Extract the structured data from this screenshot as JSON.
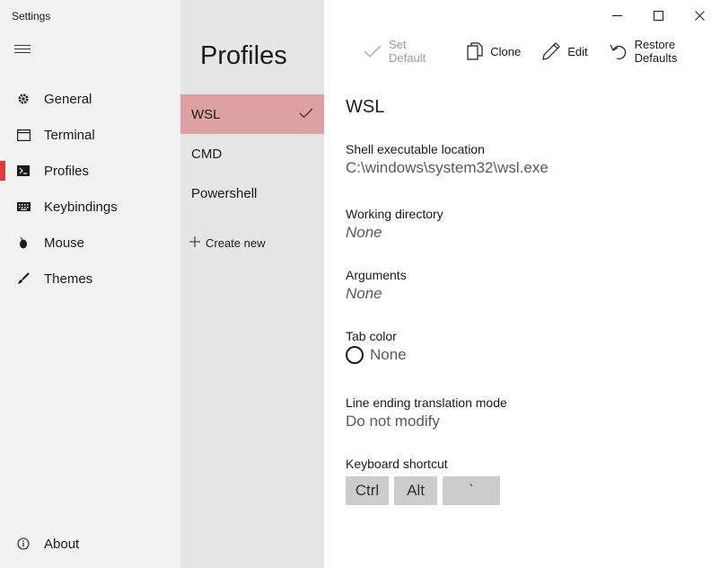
{
  "window": {
    "title": "Settings"
  },
  "nav": {
    "items": [
      {
        "label": "General",
        "icon": "gear-icon"
      },
      {
        "label": "Terminal",
        "icon": "window-icon"
      },
      {
        "label": "Profiles",
        "icon": "terminal-prompt-icon",
        "active": true
      },
      {
        "label": "Keybindings",
        "icon": "keyboard-icon"
      },
      {
        "label": "Mouse",
        "icon": "mouse-icon"
      },
      {
        "label": "Themes",
        "icon": "brush-icon"
      }
    ],
    "about": {
      "label": "About",
      "icon": "info-icon"
    }
  },
  "profiles": {
    "title": "Profiles",
    "items": [
      {
        "label": "WSL",
        "selected": true
      },
      {
        "label": "CMD"
      },
      {
        "label": "Powershell"
      }
    ],
    "create_new": "Create new"
  },
  "toolbar": {
    "set_default": "Set Default",
    "clone": "Clone",
    "edit": "Edit",
    "restore_defaults": "Restore Defaults"
  },
  "detail": {
    "name": "WSL",
    "shell_label": "Shell executable location",
    "shell_value": "C:\\windows\\system32\\wsl.exe",
    "workdir_label": "Working directory",
    "workdir_value": "None",
    "args_label": "Arguments",
    "args_value": "None",
    "tabcolor_label": "Tab color",
    "tabcolor_value": "None",
    "lineending_label": "Line ending translation mode",
    "lineending_value": "Do not modify",
    "shortcut_label": "Keyboard shortcut",
    "shortcut_keys": [
      "Ctrl",
      "Alt",
      "`"
    ]
  },
  "colors": {
    "accent": "#e0393e",
    "selected_profile": "#dea1a1",
    "nav_bg": "#f2f2f2",
    "list_bg": "#e6e6e6",
    "key_bg": "#cccccc"
  }
}
